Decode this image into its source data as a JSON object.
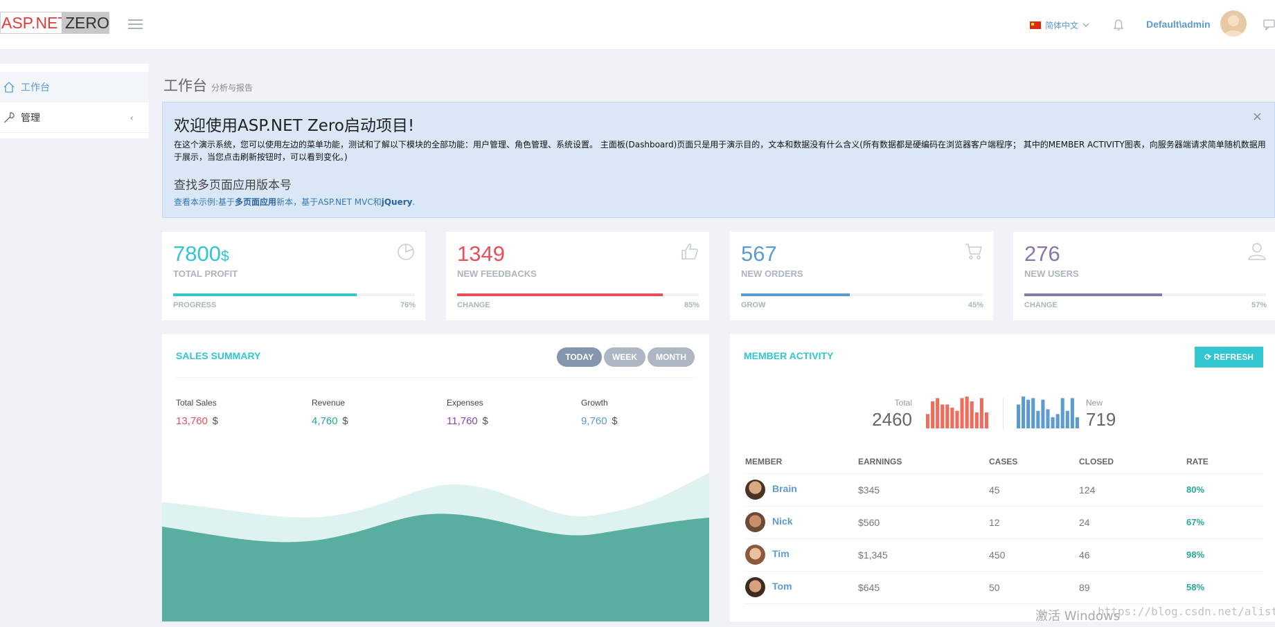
{
  "header": {
    "logo_left": "ASP.NET",
    "logo_right": "ZERO",
    "language": "简体中文",
    "username": "Default\\admin"
  },
  "sidebar": {
    "items": [
      {
        "label": "工作台",
        "icon": "home-icon"
      },
      {
        "label": "管理",
        "icon": "wrench-icon"
      }
    ]
  },
  "page": {
    "title": "工作台",
    "subtitle": "分析与报告"
  },
  "alert": {
    "heading": "欢迎使用ASP.NET Zero启动项目!",
    "body": "在这个演示系统，您可以使用左边的菜单功能，测试和了解以下模块的全部功能：用户管理、角色管理、系统设置。 主面板(Dashboard)页面只是用于演示目的，文本和数据没有什么含义(所有数据都是硬编码在浏览器客户端程序； 其中的MEMBER ACTIVITY图表，向服务器端请求简单随机数据用于展示，当您点击刷新按钮时，可以看到变化。)",
    "subheading": "查找多页面应用版本号",
    "link_prefix": "查看本示例:基于",
    "link_bold1": "多页面应用",
    "link_mid": "新本，基于ASP.NET MVC和",
    "link_bold2": "jQuery",
    "link_suffix": ".",
    "close": "×"
  },
  "stats": [
    {
      "value": "7800",
      "unit": "$",
      "label": "TOTAL PROFIT",
      "progress_label": "PROGRESS",
      "progress_text": "76%",
      "progress": 76,
      "color": "#32c5d2",
      "icon": "pie-chart-icon"
    },
    {
      "value": "1349",
      "unit": "",
      "label": "NEW FEEDBACKS",
      "progress_label": "CHANGE",
      "progress_text": "85%",
      "progress": 85,
      "color": "#e7505a",
      "icon": "thumbs-up-icon"
    },
    {
      "value": "567",
      "unit": "",
      "label": "NEW ORDERS",
      "progress_label": "GROW",
      "progress_text": "45%",
      "progress": 45,
      "color": "#5c9bd1",
      "icon": "cart-icon"
    },
    {
      "value": "276",
      "unit": "",
      "label": "NEW USERS",
      "progress_label": "CHANGE",
      "progress_text": "57%",
      "progress": 57,
      "color": "#8877a9",
      "icon": "user-icon"
    }
  ],
  "sales": {
    "title": "SALES SUMMARY",
    "buttons": [
      "TODAY",
      "WEEK",
      "MONTH"
    ],
    "metrics": [
      {
        "label": "Total Sales",
        "value": "13,760",
        "unit": "$",
        "color": "#e7505a"
      },
      {
        "label": "Revenue",
        "value": "4,760",
        "unit": "$",
        "color": "#26a69a"
      },
      {
        "label": "Expenses",
        "value": "11,760",
        "unit": "$",
        "color": "#8e44ad"
      },
      {
        "label": "Growth",
        "value": "9,760",
        "unit": "$",
        "color": "#5c9bd1"
      }
    ]
  },
  "member": {
    "title": "MEMBER ACTIVITY",
    "refresh": "REFRESH",
    "total_label": "Total",
    "total_value": "2460",
    "new_label": "New",
    "new_value": "719",
    "total_bars": [
      0.45,
      0.85,
      0.95,
      0.75,
      0.75,
      0.65,
      0.55,
      0.95,
      1.0,
      0.85,
      0.5,
      0.95,
      0.5
    ],
    "new_bars": [
      0.75,
      1.0,
      0.9,
      0.95,
      0.55,
      0.9,
      0.6,
      0.35,
      0.45,
      0.95,
      0.55,
      0.95,
      0.35
    ],
    "columns": [
      "MEMBER",
      "EARNINGS",
      "CASES",
      "CLOSED",
      "RATE"
    ],
    "rows": [
      {
        "name": "Brain",
        "earnings": "$345",
        "cases": "45",
        "closed": "124",
        "rate": "80%"
      },
      {
        "name": "Nick",
        "earnings": "$560",
        "cases": "12",
        "closed": "24",
        "rate": "67%"
      },
      {
        "name": "Tim",
        "earnings": "$1,345",
        "cases": "450",
        "closed": "46",
        "rate": "98%"
      },
      {
        "name": "Tom",
        "earnings": "$645",
        "cases": "50",
        "closed": "89",
        "rate": "58%"
      }
    ]
  },
  "watermark": {
    "windows": "激活 Windows",
    "url": "https://blog.csdn.net/alistair_chow"
  }
}
